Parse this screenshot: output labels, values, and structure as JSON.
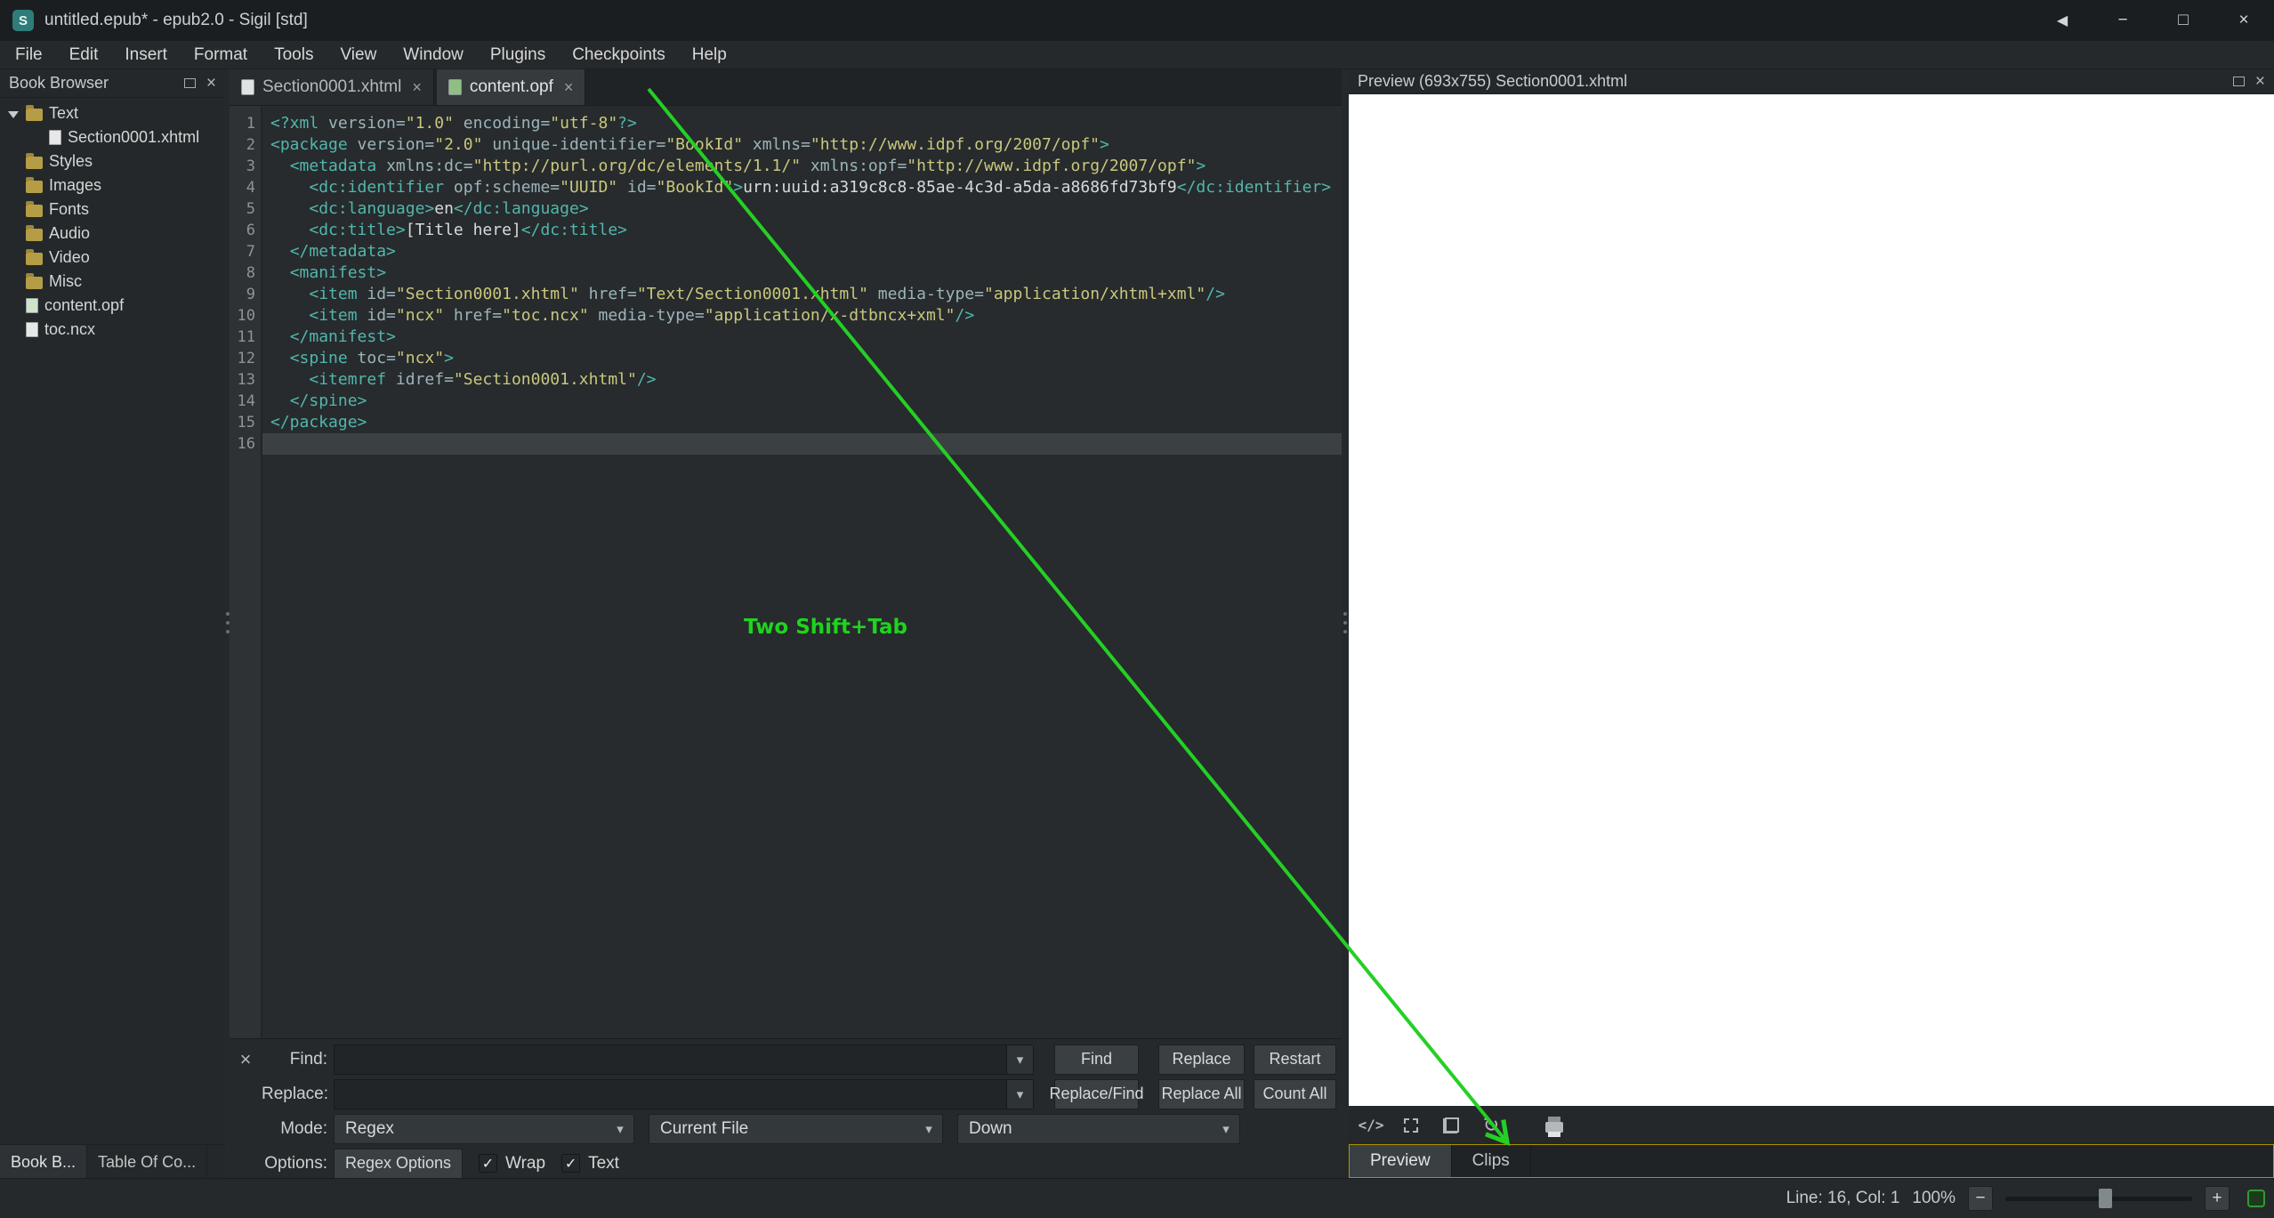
{
  "window": {
    "title": "untitled.epub* - epub2.0 - Sigil [std]",
    "controls": {
      "back": "◀",
      "minimize": "−",
      "maximize": "□",
      "close": "×"
    }
  },
  "menu_bar": {
    "items": [
      "File",
      "Edit",
      "Insert",
      "Format",
      "Tools",
      "View",
      "Window",
      "Plugins",
      "Checkpoints",
      "Help"
    ]
  },
  "book_browser": {
    "title": "Book Browser",
    "items": [
      {
        "label": "Text",
        "type": "folder",
        "expanded": true,
        "depth": 0
      },
      {
        "label": "Section0001.xhtml",
        "type": "file",
        "depth": 1
      },
      {
        "label": "Styles",
        "type": "folder",
        "depth": 0
      },
      {
        "label": "Images",
        "type": "folder",
        "depth": 0
      },
      {
        "label": "Fonts",
        "type": "folder",
        "depth": 0
      },
      {
        "label": "Audio",
        "type": "folder",
        "depth": 0
      },
      {
        "label": "Video",
        "type": "folder",
        "depth": 0
      },
      {
        "label": "Misc",
        "type": "folder",
        "depth": 0
      },
      {
        "label": "content.opf",
        "type": "file-opf",
        "depth": 0
      },
      {
        "label": "toc.ncx",
        "type": "file",
        "depth": 0
      }
    ],
    "bottom_tabs": [
      {
        "label": "Book B...",
        "active": true
      },
      {
        "label": "Table Of Co...",
        "active": false
      }
    ]
  },
  "editor_tabs": [
    {
      "label": "Section0001.xhtml",
      "active": false,
      "icon": "html-file"
    },
    {
      "label": "content.opf",
      "active": true,
      "icon": "opf-file"
    }
  ],
  "editor": {
    "current_line": 16,
    "lines": [
      [
        [
          "g",
          "<?xml"
        ],
        [
          "a",
          " version="
        ],
        [
          "v",
          "\"1.0\""
        ],
        [
          "a",
          " encoding="
        ],
        [
          "v",
          "\"utf-8\""
        ],
        [
          "g",
          "?>"
        ]
      ],
      [
        [
          "g",
          "<package"
        ],
        [
          "a",
          " version="
        ],
        [
          "v",
          "\"2.0\""
        ],
        [
          "a",
          " unique-identifier="
        ],
        [
          "v",
          "\"BookId\""
        ],
        [
          "a",
          " xmlns="
        ],
        [
          "v",
          "\"http://www.idpf.org/2007/opf\""
        ],
        [
          "g",
          ">"
        ]
      ],
      [
        [
          "t",
          "  "
        ],
        [
          "g",
          "<metadata"
        ],
        [
          "a",
          " xmlns:dc="
        ],
        [
          "v",
          "\"http://purl.org/dc/elements/1.1/\""
        ],
        [
          "a",
          " xmlns:opf="
        ],
        [
          "v",
          "\"http://www.idpf.org/2007/opf\""
        ],
        [
          "g",
          ">"
        ]
      ],
      [
        [
          "t",
          "    "
        ],
        [
          "g",
          "<dc:identifier"
        ],
        [
          "a",
          " opf:scheme="
        ],
        [
          "v",
          "\"UUID\""
        ],
        [
          "a",
          " id="
        ],
        [
          "v",
          "\"BookId\""
        ],
        [
          "g",
          ">"
        ],
        [
          "t",
          "urn:uuid:a319c8c8-85ae-4c3d-a5da-a8686fd73bf9"
        ],
        [
          "g",
          "</dc:identifier>"
        ]
      ],
      [
        [
          "t",
          "    "
        ],
        [
          "g",
          "<dc:language>"
        ],
        [
          "t",
          "en"
        ],
        [
          "g",
          "</dc:language>"
        ]
      ],
      [
        [
          "t",
          "    "
        ],
        [
          "g",
          "<dc:title>"
        ],
        [
          "t",
          "[Title here]"
        ],
        [
          "g",
          "</dc:title>"
        ]
      ],
      [
        [
          "t",
          "  "
        ],
        [
          "g",
          "</metadata>"
        ]
      ],
      [
        [
          "t",
          "  "
        ],
        [
          "g",
          "<manifest>"
        ]
      ],
      [
        [
          "t",
          "    "
        ],
        [
          "g",
          "<item"
        ],
        [
          "a",
          " id="
        ],
        [
          "v",
          "\"Section0001.xhtml\""
        ],
        [
          "a",
          " href="
        ],
        [
          "v",
          "\"Text/Section0001.xhtml\""
        ],
        [
          "a",
          " media-type="
        ],
        [
          "v",
          "\"application/xhtml+xml\""
        ],
        [
          "g",
          "/>"
        ]
      ],
      [
        [
          "t",
          "    "
        ],
        [
          "g",
          "<item"
        ],
        [
          "a",
          " id="
        ],
        [
          "v",
          "\"ncx\""
        ],
        [
          "a",
          " href="
        ],
        [
          "v",
          "\"toc.ncx\""
        ],
        [
          "a",
          " media-type="
        ],
        [
          "v",
          "\"application/x-dtbncx+xml\""
        ],
        [
          "g",
          "/>"
        ]
      ],
      [
        [
          "t",
          "  "
        ],
        [
          "g",
          "</manifest>"
        ]
      ],
      [
        [
          "t",
          "  "
        ],
        [
          "g",
          "<spine"
        ],
        [
          "a",
          " toc="
        ],
        [
          "v",
          "\"ncx\""
        ],
        [
          "g",
          ">"
        ]
      ],
      [
        [
          "t",
          "    "
        ],
        [
          "g",
          "<itemref"
        ],
        [
          "a",
          " idref="
        ],
        [
          "v",
          "\"Section0001.xhtml\""
        ],
        [
          "g",
          "/>"
        ]
      ],
      [
        [
          "t",
          "  "
        ],
        [
          "g",
          "</spine>"
        ]
      ],
      [
        [
          "g",
          "</package>"
        ]
      ],
      []
    ]
  },
  "annotation": {
    "label": "Two Shift+Tab",
    "color": "#1ed41e"
  },
  "arrow": {
    "color": "#25cf25"
  },
  "find_replace": {
    "find_label": "Find:",
    "find_value": "",
    "replace_label": "Replace:",
    "replace_value": "",
    "mode_label": "Mode:",
    "options_label": "Options:",
    "find_button": "Find",
    "replace_button": "Replace",
    "restart_button": "Restart",
    "replace_find_button": "Replace/Find",
    "replace_all_button": "Replace All",
    "count_all_button": "Count All",
    "mode_value": "Regex",
    "scope_value": "Current File",
    "direction_value": "Down",
    "regex_options_button": "Regex Options",
    "wrap_checkbox": {
      "label": "Wrap",
      "checked": true
    },
    "text_checkbox": {
      "label": "Text",
      "checked": true
    },
    "dropdown_arrow": "▾",
    "check_glyph": "✓",
    "close_glyph": "×"
  },
  "preview": {
    "title": "Preview (693x755) Section0001.xhtml",
    "tabs": [
      {
        "label": "Preview",
        "active": true
      },
      {
        "label": "Clips",
        "active": false
      }
    ],
    "toolbar_icons": [
      "code-view",
      "inspect",
      "copy",
      "rotate",
      "print"
    ],
    "icon_glyphs": {
      "code_view": "</>",
      "rotate": "↻"
    }
  },
  "status_bar": {
    "cursor_position": "Line: 16, Col: 1",
    "zoom_level": "100%",
    "zoom_out": "−",
    "zoom_in": "+"
  },
  "colors": {
    "annotation_green": "#1ed41e",
    "arrow_green": "#25cf25",
    "highlight_yellow": "#ab9400",
    "syntax_tag": "#52b6ad",
    "syntax_attr": "#9cb4ba",
    "syntax_value": "#c9c77d",
    "syntax_text": "#d8dadb"
  }
}
